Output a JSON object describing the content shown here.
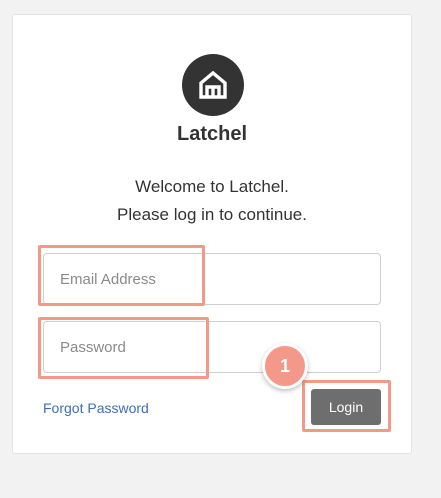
{
  "brand": {
    "name": "Latchel",
    "logo_icon": "house-icon",
    "logo_color": "#333333"
  },
  "welcome": {
    "line1": "Welcome to Latchel.",
    "line2": "Please log in to continue."
  },
  "form": {
    "email_placeholder": "Email Address",
    "email_value": "",
    "password_placeholder": "Password",
    "password_value": "",
    "forgot_label": "Forgot Password",
    "login_label": "Login"
  },
  "annotation": {
    "step_number": "1",
    "highlight_color": "#f4998a"
  },
  "colors": {
    "link": "#3b6fb6",
    "button": "#6e6e6e"
  }
}
